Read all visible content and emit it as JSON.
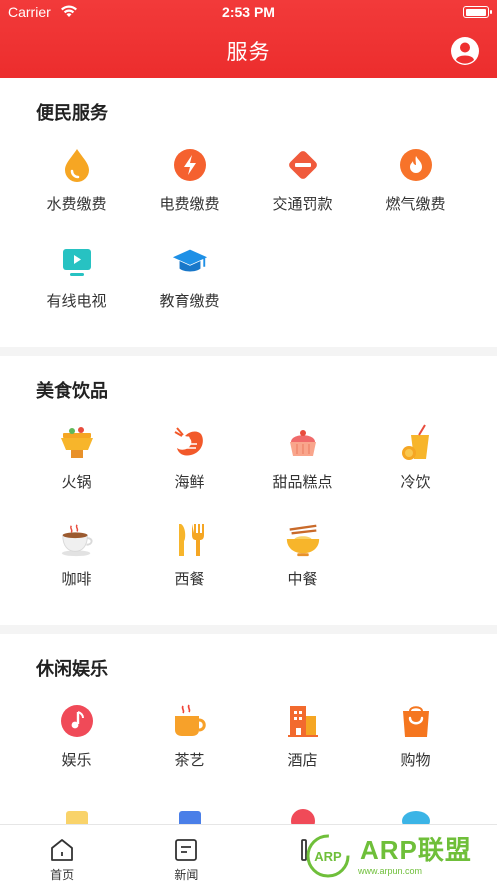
{
  "status": {
    "carrier": "Carrier",
    "time": "2:53 PM"
  },
  "header": {
    "title": "服务"
  },
  "sections": [
    {
      "title": "便民服务",
      "items": [
        {
          "label": "水费缴费",
          "icon": "water-drop-icon"
        },
        {
          "label": "电费缴费",
          "icon": "lightning-icon"
        },
        {
          "label": "交通罚款",
          "icon": "traffic-sign-icon"
        },
        {
          "label": "燃气缴费",
          "icon": "flame-icon"
        },
        {
          "label": "有线电视",
          "icon": "tv-icon"
        },
        {
          "label": "教育缴费",
          "icon": "graduation-cap-icon"
        }
      ]
    },
    {
      "title": "美食饮品",
      "items": [
        {
          "label": "火锅",
          "icon": "hotpot-icon"
        },
        {
          "label": "海鲜",
          "icon": "shrimp-icon"
        },
        {
          "label": "甜品糕点",
          "icon": "cupcake-icon"
        },
        {
          "label": "冷饮",
          "icon": "cold-drink-icon"
        },
        {
          "label": "咖啡",
          "icon": "coffee-icon"
        },
        {
          "label": "西餐",
          "icon": "fork-knife-icon"
        },
        {
          "label": "中餐",
          "icon": "noodle-bowl-icon"
        }
      ]
    },
    {
      "title": "休闲娱乐",
      "items": [
        {
          "label": "娱乐",
          "icon": "music-icon"
        },
        {
          "label": "茶艺",
          "icon": "tea-cup-icon"
        },
        {
          "label": "酒店",
          "icon": "hotel-icon"
        },
        {
          "label": "购物",
          "icon": "shopping-bag-icon"
        }
      ]
    }
  ],
  "tabbar": [
    {
      "label": "首页",
      "icon": "home-icon"
    },
    {
      "label": "新闻",
      "icon": "news-icon"
    }
  ],
  "watermark": {
    "text": "ARP联盟",
    "url": "www.arpun.com",
    "badge": "ARP"
  },
  "colors": {
    "header": "#ef3333",
    "accent_orange": "#f57a1f",
    "accent_red": "#f04438"
  }
}
